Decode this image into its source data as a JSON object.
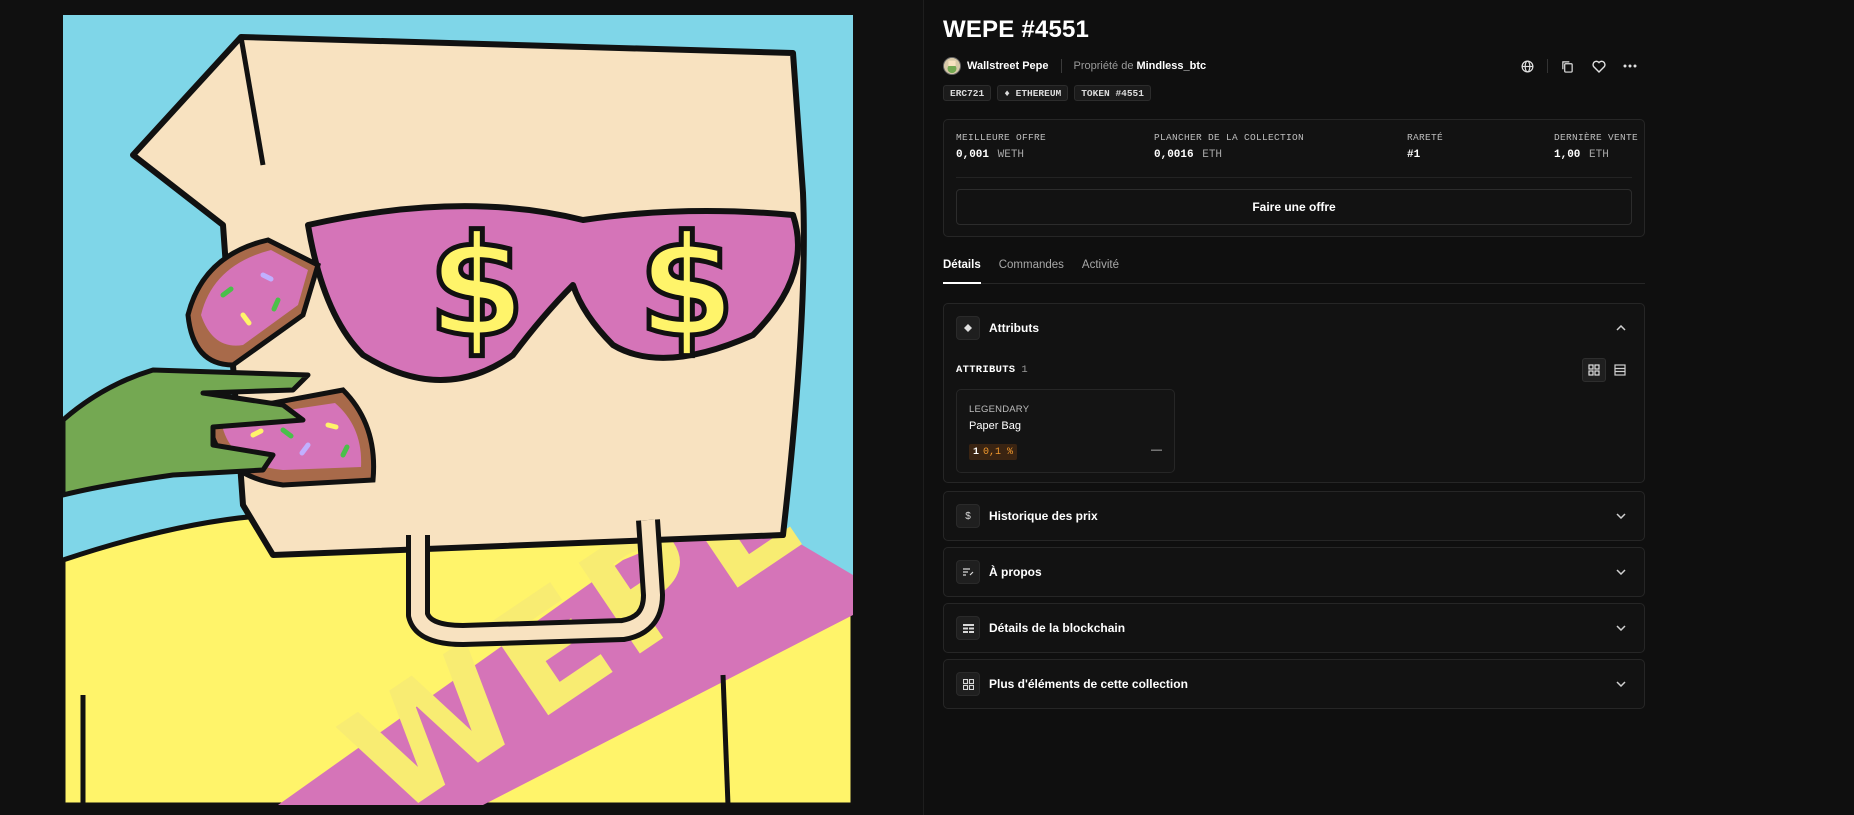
{
  "nft": {
    "title": "WEPE #4551",
    "collection_name": "Wallstreet Pepe",
    "owner_label": "Propriété de",
    "owner_name": "Mindless_btc",
    "chips": [
      "ERC721",
      "♦ ETHEREUM",
      "TOKEN #4551"
    ]
  },
  "offer": {
    "stats": [
      {
        "label": "MEILLEURE OFFRE",
        "value": "0,001",
        "unit": "WETH"
      },
      {
        "label": "PLANCHER DE LA COLLECTION",
        "value": "0,0016",
        "unit": "ETH"
      },
      {
        "label": "RARETÉ",
        "value": "#1",
        "unit": ""
      },
      {
        "label": "DERNIÈRE VENTE",
        "value": "1,00",
        "unit": "ETH"
      }
    ],
    "button_label": "Faire une offre"
  },
  "tabs": [
    {
      "label": "Détails",
      "active": true
    },
    {
      "label": "Commandes",
      "active": false
    },
    {
      "label": "Activité",
      "active": false
    }
  ],
  "attributes": {
    "title": "Attributs",
    "count_label": "ATTRIBUTS",
    "count": "1",
    "traits": [
      {
        "type": "LEGENDARY",
        "value": "Paper Bag",
        "rank": "1",
        "percent": "0,1 %",
        "price": "—"
      }
    ]
  },
  "sections": [
    {
      "title": "Historique des prix",
      "icon": "dollar-icon"
    },
    {
      "title": "À propos",
      "icon": "text-edit-icon"
    },
    {
      "title": "Détails de la blockchain",
      "icon": "table-icon"
    },
    {
      "title": "Plus d'éléments de cette collection",
      "icon": "grid-icon"
    }
  ],
  "artwork": {
    "sash_text": "WEPE"
  },
  "colors": {
    "background": "#0f0f0f",
    "art_sky": "#7fd6e8",
    "art_bag": "#f8e2c0",
    "art_pink": "#d574b8",
    "art_yellow": "#fff46a",
    "art_green": "#74a852",
    "rarity_accent": "#f39a2e"
  }
}
